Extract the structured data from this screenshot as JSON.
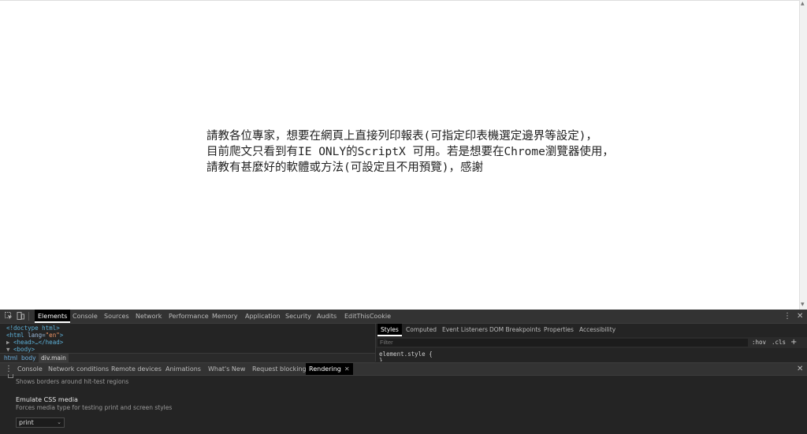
{
  "page": {
    "lines": [
      "請教各位專家，想要在網頁上直接列印報表(可指定印表機選定邊界等設定)，",
      "目前爬文只看到有IE ONLY的ScriptX 可用。若是想要在Chrome瀏覽器使用，",
      "請教有甚麼好的軟體或方法(可設定且不用預覽)，感謝"
    ]
  },
  "devtools": {
    "tabs": [
      "Elements",
      "Console",
      "Sources",
      "Network",
      "Performance",
      "Memory",
      "Application",
      "Security",
      "Audits",
      "EditThisCookie"
    ],
    "elements": {
      "doctype": "<!doctype html>",
      "html_open_tag": "<html",
      "lang_attr": " lang=",
      "lang_value": "\"en\"",
      "html_close_bracket": ">",
      "head_line": "<head>…</head>",
      "body_line": "<body>"
    },
    "breadcrumbs": [
      "html",
      "body",
      "div.main"
    ],
    "styles": {
      "tabs": [
        "Styles",
        "Computed",
        "Event Listeners",
        "DOM Breakpoints",
        "Properties",
        "Accessibility"
      ],
      "filter_placeholder": "Filter",
      "hov": ":hov",
      "cls": ".cls",
      "plus": "+",
      "element_style": "element.style {",
      "close_brace": "}"
    },
    "drawer": {
      "tabs": [
        "Console",
        "Network conditions",
        "Remote devices",
        "Animations",
        "What's New",
        "Request blocking",
        "Rendering"
      ],
      "active": "Rendering"
    },
    "rendering": {
      "hit_test_desc": "Shows borders around hit-test regions",
      "emulate_title": "Emulate CSS media",
      "emulate_desc": "Forces media type for testing print and screen styles",
      "media_value": "print"
    }
  }
}
